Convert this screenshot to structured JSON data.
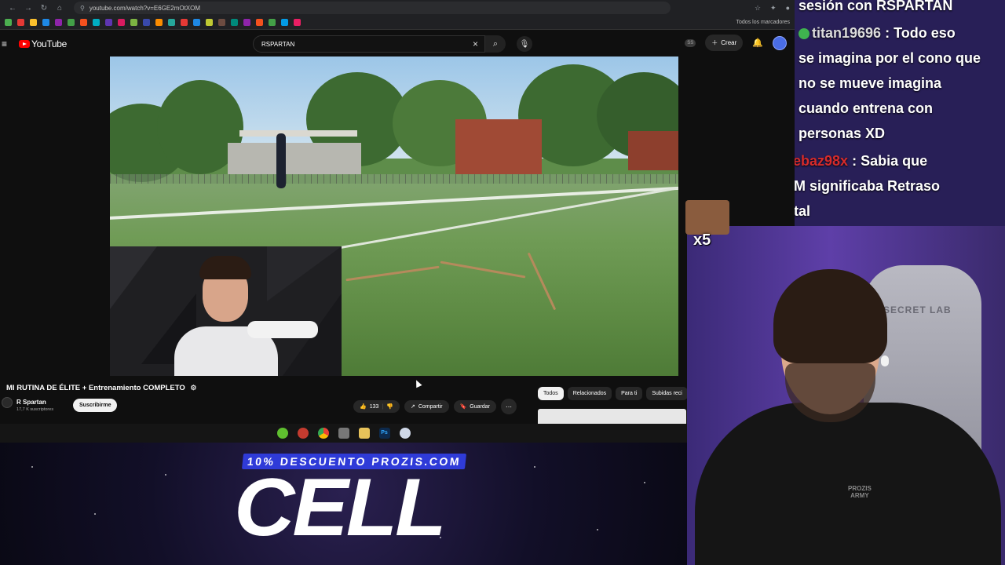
{
  "browser": {
    "url": "youtube.com/watch?v=E6GE2mOtXOM",
    "bookmarks_folder": "Todos los marcadores"
  },
  "youtube": {
    "logo_text": "YouTube",
    "search_value": "RSPARTAN",
    "create_label": "Crear",
    "video_title": "MI RUTINA DE ÉLITE + Entrenamiento COMPLETO",
    "channel_name": "R Spartan",
    "subscribers": "17,7 K suscriptores",
    "subscribe_label": "Suscribirme",
    "like_count": "133",
    "share_label": "Compartir",
    "save_label": "Guardar",
    "chips": [
      "Todos",
      "Relacionados",
      "Para ti",
      "Subidas reci"
    ]
  },
  "chat": {
    "lines": [
      {
        "user": "",
        "text": "sesión con RSPARTAN"
      },
      {
        "user": "titan19696",
        "text": ": Todo eso"
      },
      {
        "user": "",
        "text": "se imagina por el cono que"
      },
      {
        "user": "",
        "text": "no se mueve imagina"
      },
      {
        "user": "",
        "text": "cuando entrena con"
      },
      {
        "user": "",
        "text": "personas XD"
      },
      {
        "user": "ebaz98x",
        "text": ": Sabia que"
      },
      {
        "user": "",
        "text": "M significaba Retraso"
      },
      {
        "user": "",
        "text": "tal"
      }
    ],
    "emote_multiplier": "x5"
  },
  "sponsor": {
    "promo_tag": "10% DESCUENTO PROZIS.COM",
    "brand": "CELL"
  },
  "colors": {
    "yt_red": "#ff0000",
    "chat_bg": "#281f57",
    "promo_blue": "#2f3bd8"
  }
}
